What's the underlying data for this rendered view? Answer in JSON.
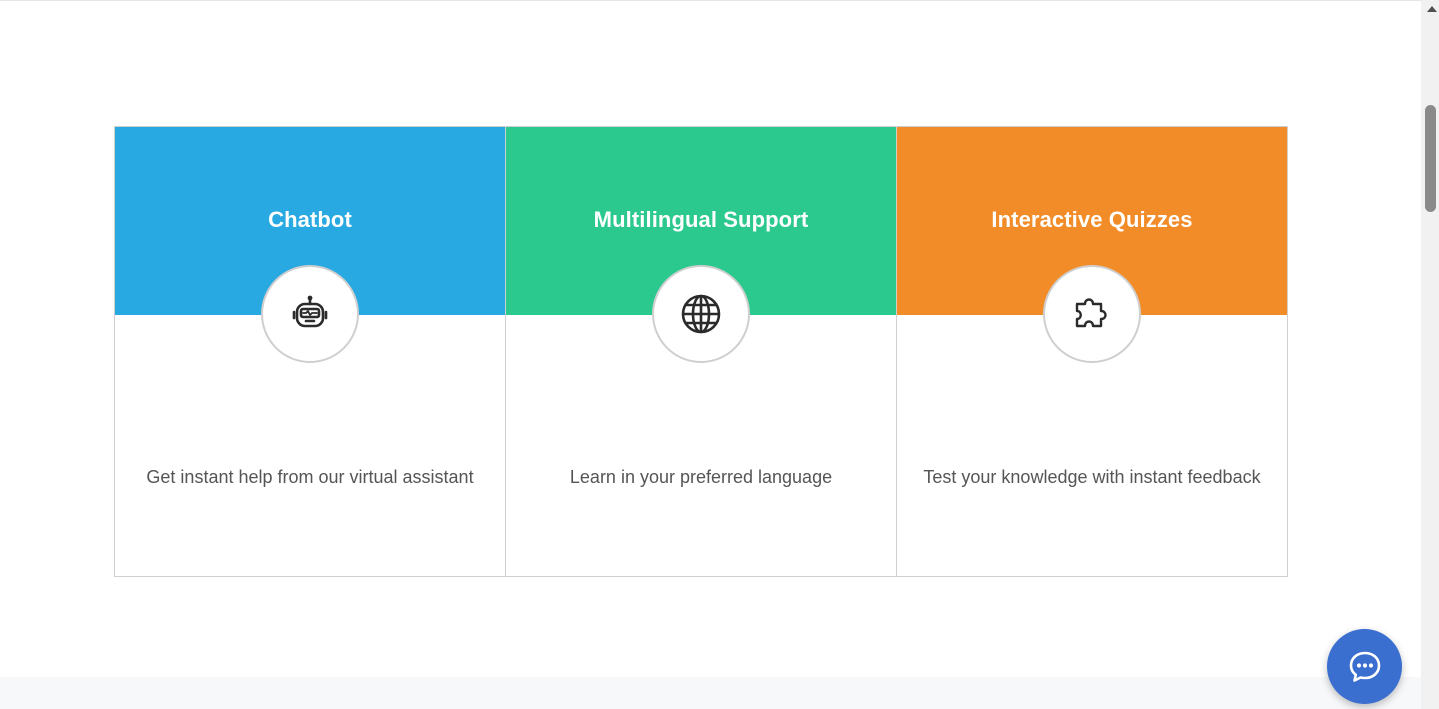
{
  "features": [
    {
      "title": "Chatbot",
      "description": "Get instant help from our virtual assistant",
      "color": "#29a9e1",
      "icon": "robot-icon"
    },
    {
      "title": "Multilingual Support",
      "description": "Learn in your preferred language",
      "color": "#2cc98f",
      "icon": "globe-icon"
    },
    {
      "title": "Interactive Quizzes",
      "description": "Test your knowledge with instant feedback",
      "color": "#f28c28",
      "icon": "puzzle-icon"
    }
  ],
  "chat_widget": {
    "icon": "chat-bubble-icon",
    "color": "#3b6fcf"
  }
}
